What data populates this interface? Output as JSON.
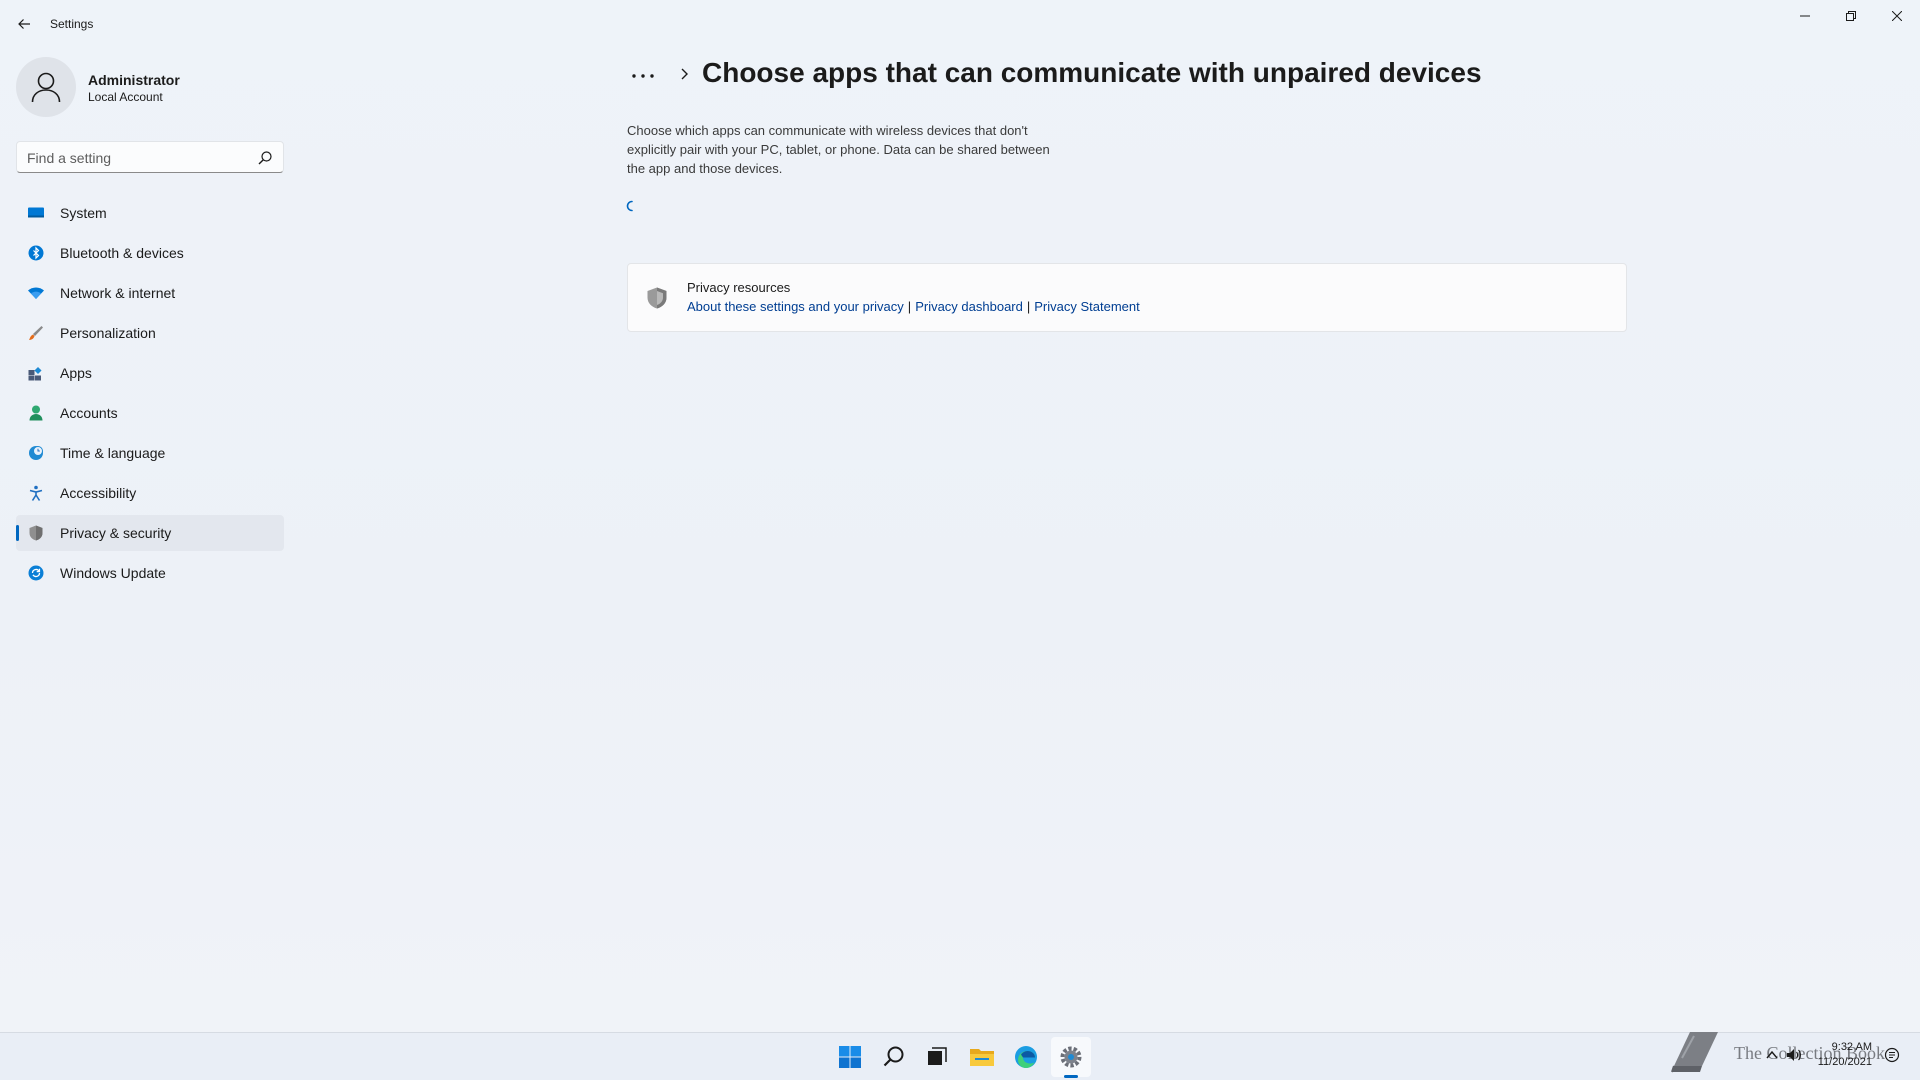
{
  "window": {
    "app_title": "Settings"
  },
  "profile": {
    "name": "Administrator",
    "account_type": "Local Account"
  },
  "search": {
    "placeholder": "Find a setting"
  },
  "sidebar": {
    "items": [
      {
        "label": "System",
        "icon": "system-icon",
        "color": "#0078d4"
      },
      {
        "label": "Bluetooth & devices",
        "icon": "bluetooth-icon",
        "color": "#0078d4"
      },
      {
        "label": "Network & internet",
        "icon": "wifi-icon",
        "color": "#0078d4"
      },
      {
        "label": "Personalization",
        "icon": "brush-icon",
        "color": "#e46c1b"
      },
      {
        "label": "Apps",
        "icon": "apps-icon",
        "color": "#4a5a78"
      },
      {
        "label": "Accounts",
        "icon": "person-icon",
        "color": "#2ea871"
      },
      {
        "label": "Time & language",
        "icon": "globe-clock-icon",
        "color": "#1f8ad3"
      },
      {
        "label": "Accessibility",
        "icon": "accessibility-icon",
        "color": "#1f6fc1"
      },
      {
        "label": "Privacy & security",
        "icon": "shield-icon",
        "color": "#6f6f6f",
        "selected": true
      },
      {
        "label": "Windows Update",
        "icon": "update-icon",
        "color": "#0a7fd6"
      }
    ]
  },
  "content": {
    "breadcrumb_more": "...",
    "title": "Choose apps that can communicate with unpaired devices",
    "description": "Choose which apps can communicate with wireless devices that don't explicitly pair with your PC, tablet, or phone. Data can be shared between the app and those devices.",
    "privacy_card": {
      "title": "Privacy resources",
      "links": [
        "About these settings and your privacy",
        "Privacy dashboard",
        "Privacy Statement"
      ],
      "separator": "|"
    }
  },
  "taskbar": {
    "apps": [
      "start-icon",
      "search-icon",
      "task-view-icon",
      "file-explorer-icon",
      "edge-icon",
      "settings-icon"
    ],
    "active_app": "settings-icon",
    "watermark": "The Collection Book",
    "time": "9:32 AM",
    "date": "11/20/2021"
  },
  "colors": {
    "accent": "#0067c0",
    "link": "#003e92"
  }
}
